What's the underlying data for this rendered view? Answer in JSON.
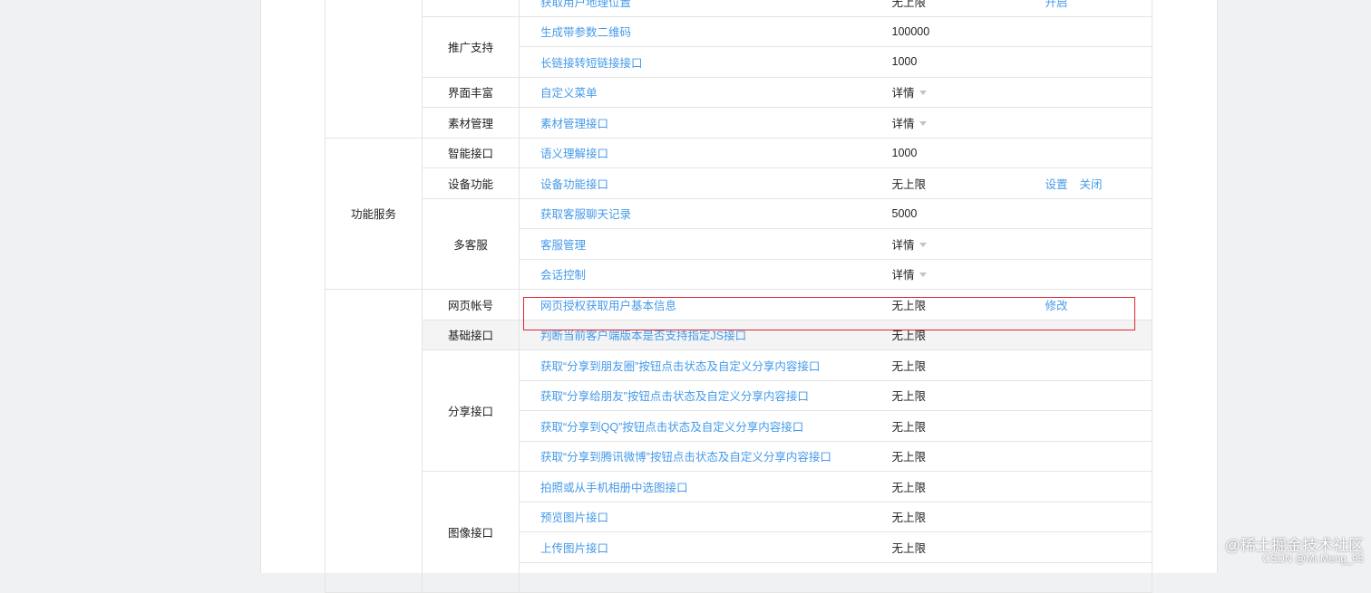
{
  "rows": [
    {
      "cat": "",
      "catRowspan": 5,
      "group": "",
      "groupRowspan": 1,
      "name": "获取用户地理位置",
      "quota": "无上限",
      "ops": [
        "开启"
      ]
    },
    {
      "group": "推广支持",
      "groupRowspan": 2,
      "name": "生成带参数二维码",
      "quota": "100000",
      "ops": []
    },
    {
      "name": "长链接转短链接接口",
      "quota": "1000",
      "ops": []
    },
    {
      "group": "界面丰富",
      "groupRowspan": 1,
      "name": "自定义菜单",
      "quota": "详情",
      "detail": true,
      "ops": []
    },
    {
      "group": "素材管理",
      "groupRowspan": 1,
      "name": "素材管理接口",
      "quota": "详情",
      "detail": true,
      "ops": []
    },
    {
      "cat": "功能服务",
      "catRowspan": 5,
      "group": "智能接口",
      "groupRowspan": 1,
      "name": "语义理解接口",
      "quota": "1000",
      "ops": []
    },
    {
      "group": "设备功能",
      "groupRowspan": 1,
      "name": "设备功能接口",
      "quota": "无上限",
      "ops": [
        "设置",
        "关闭"
      ]
    },
    {
      "group": "多客服",
      "groupRowspan": 3,
      "name": "获取客服聊天记录",
      "quota": "5000",
      "ops": []
    },
    {
      "name": "客服管理",
      "quota": "详情",
      "detail": true,
      "ops": []
    },
    {
      "name": "会话控制",
      "quota": "详情",
      "detail": true,
      "ops": []
    },
    {
      "cat": "",
      "catRowspan": 10,
      "group": "网页帐号",
      "groupRowspan": 1,
      "name": "网页授权获取用户基本信息",
      "quota": "无上限",
      "ops": [
        "修改"
      ]
    },
    {
      "group": "基础接口",
      "groupRowspan": 1,
      "name": "判断当前客户端版本是否支持指定JS接口",
      "quota": "无上限",
      "ops": [],
      "highlight": true
    },
    {
      "group": "分享接口",
      "groupRowspan": 4,
      "name": "获取“分享到朋友圈”按钮点击状态及自定义分享内容接口",
      "quota": "无上限",
      "ops": []
    },
    {
      "name": "获取“分享给朋友”按钮点击状态及自定义分享内容接口",
      "quota": "无上限",
      "ops": []
    },
    {
      "name": "获取“分享到QQ”按钮点击状态及自定义分享内容接口",
      "quota": "无上限",
      "ops": []
    },
    {
      "name": "获取“分享到腾讯微博”按钮点击状态及自定义分享内容接口",
      "quota": "无上限",
      "ops": []
    },
    {
      "group": "图像接口",
      "groupRowspan": 4,
      "name": "拍照或从手机相册中选图接口",
      "quota": "无上限",
      "ops": []
    },
    {
      "name": "预览图片接口",
      "quota": "无上限",
      "ops": []
    },
    {
      "name": "上传图片接口",
      "quota": "无上限",
      "ops": []
    },
    {
      "name": "",
      "quota": "",
      "ops": []
    }
  ],
  "watermark": {
    "main": "@稀土掘金技术社区",
    "sub": "CSDN @Mr.Meng_95"
  }
}
